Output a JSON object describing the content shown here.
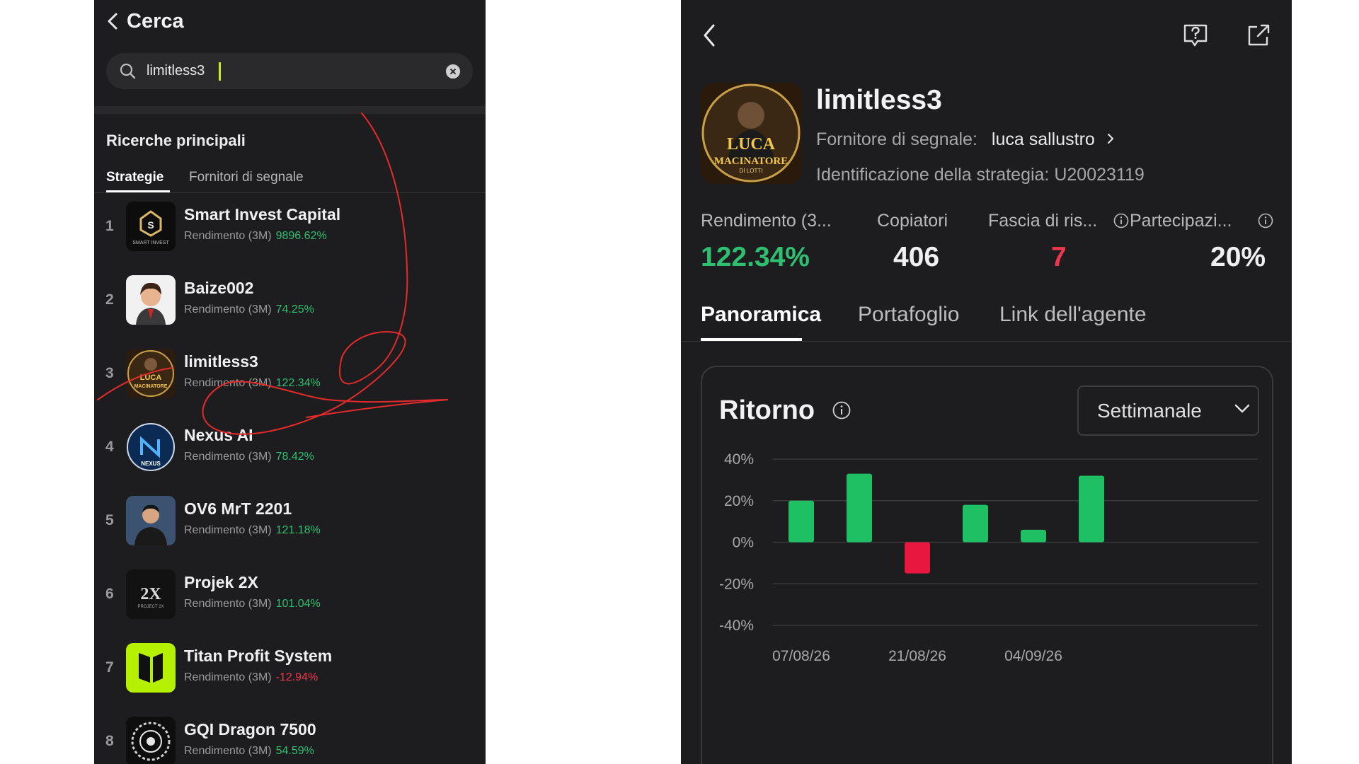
{
  "left": {
    "title": "Cerca",
    "search": {
      "value": "limitless3",
      "placeholder": ""
    },
    "section_title": "Ricerche principali",
    "tabs": [
      {
        "label": "Strategie",
        "active": true
      },
      {
        "label": "Fornitori di segnale",
        "active": false
      }
    ],
    "list_label": "Rendimento (3M)",
    "items": [
      {
        "rank": "1",
        "name": "Smart Invest Capital",
        "return": "9896.62%",
        "positive": true
      },
      {
        "rank": "2",
        "name": "Baize002",
        "return": "74.25%",
        "positive": true
      },
      {
        "rank": "3",
        "name": "limitless3",
        "return": "122.34%",
        "positive": true
      },
      {
        "rank": "4",
        "name": "Nexus AI",
        "return": "78.42%",
        "positive": true
      },
      {
        "rank": "5",
        "name": "OV6 MrT 2201",
        "return": "121.18%",
        "positive": true
      },
      {
        "rank": "6",
        "name": "Projek 2X",
        "return": "101.04%",
        "positive": true
      },
      {
        "rank": "7",
        "name": "Titan Profit System",
        "return": "-12.94%",
        "positive": false
      },
      {
        "rank": "8",
        "name": "GQI Dragon 7500",
        "return": "54.59%",
        "positive": true
      }
    ],
    "avatar_texts": {
      "smart": "SMART INVEST",
      "luca_top": "LUCA",
      "luca_bottom": "MACINATORE",
      "luca_sub": "DI LOTTI",
      "nexus": "NEXUS",
      "projek": "2X",
      "projek_sub": "PROJECT 2X"
    }
  },
  "right": {
    "name": "limitless3",
    "provider_label": "Fornitore di segnale:",
    "provider_name": "luca sallustro",
    "strategy_id_label": "Identificazione della strategia:",
    "strategy_id": "U20023119",
    "stats": [
      {
        "label": "Rendimento (3...",
        "value": "122.34%",
        "color": "#2fbf71"
      },
      {
        "label": "Copiatori",
        "value": "406",
        "color": "#f0f0f0"
      },
      {
        "label": "Fascia di ris...",
        "value": "7",
        "color": "#f0354f"
      },
      {
        "label": "Partecipazi...",
        "value": "20%",
        "color": "#f0f0f0"
      }
    ],
    "tabs": [
      "Panoramica",
      "Portafoglio",
      "Link dell'agente"
    ],
    "card_title": "Ritorno",
    "dropdown": "Settimanale"
  },
  "chart_data": {
    "type": "bar",
    "title": "Ritorno",
    "period": "Settimanale",
    "x_tick_labels": [
      "07/08/26",
      "21/08/26",
      "04/09/26"
    ],
    "y_tick_labels": [
      "40%",
      "20%",
      "0%",
      "-20%",
      "-40%"
    ],
    "ylim": [
      -40,
      40
    ],
    "grid": true,
    "values": [
      20,
      33,
      -15,
      18,
      6,
      32
    ],
    "colors": {
      "positive": "#1fbf64",
      "negative": "#e8173f"
    }
  }
}
